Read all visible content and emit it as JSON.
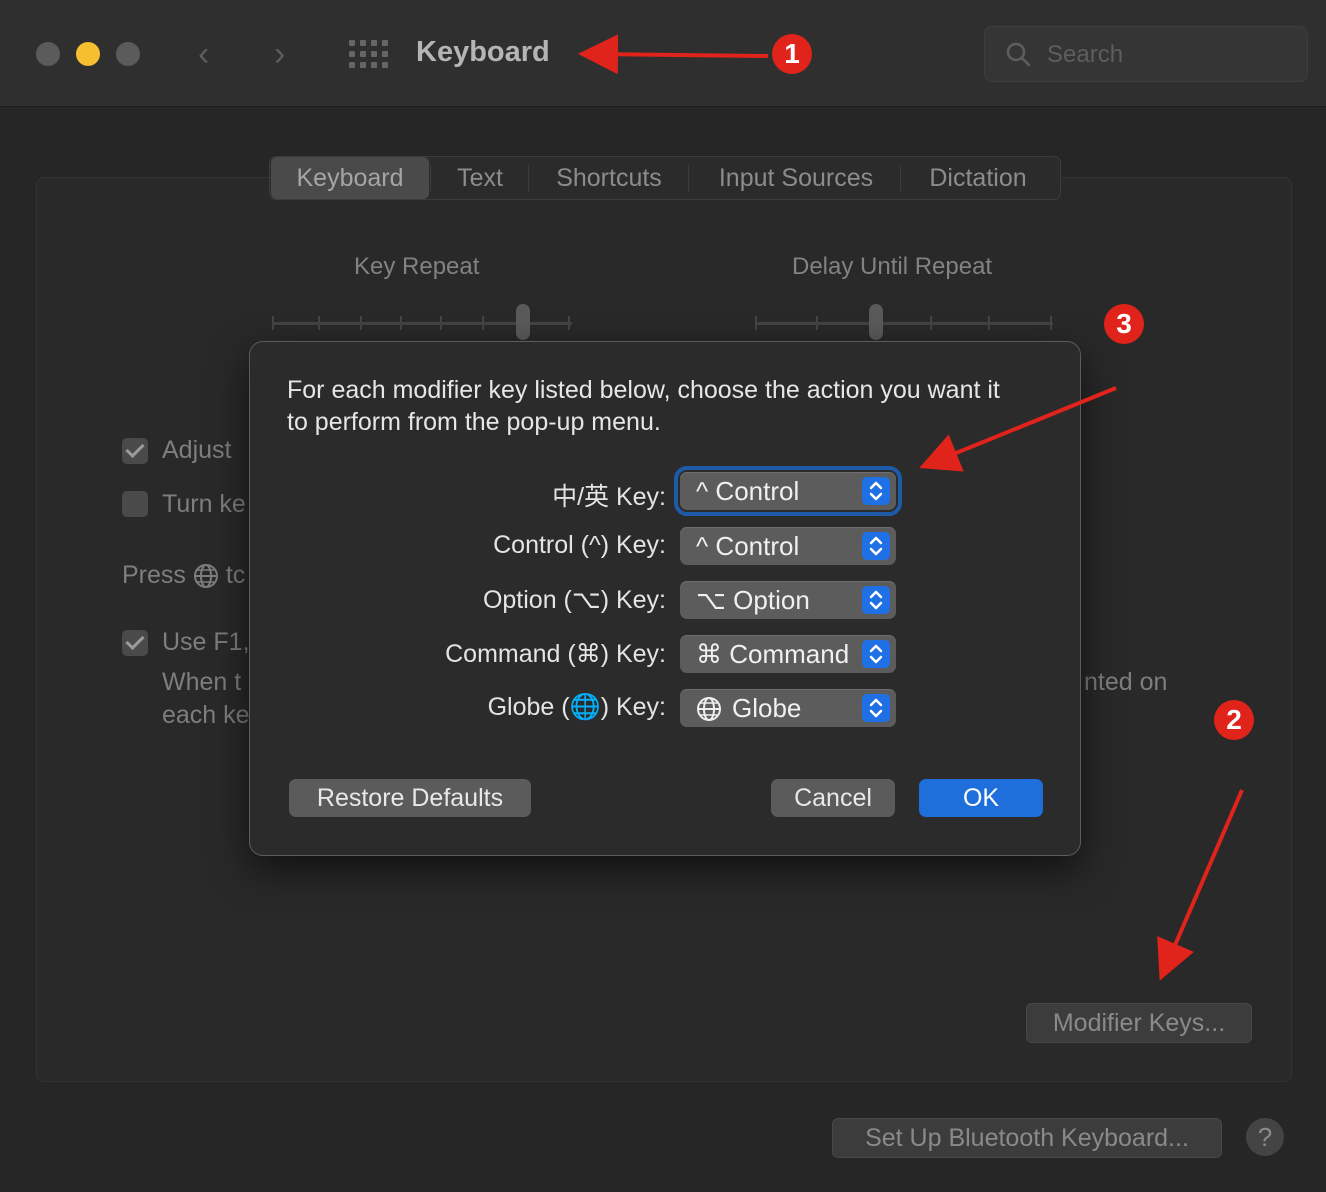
{
  "window": {
    "title": "Keyboard",
    "search_placeholder": "Search"
  },
  "tabs": [
    {
      "label": "Keyboard",
      "selected": true
    },
    {
      "label": "Text",
      "selected": false
    },
    {
      "label": "Shortcuts",
      "selected": false
    },
    {
      "label": "Input Sources",
      "selected": false
    },
    {
      "label": "Dictation",
      "selected": false
    }
  ],
  "sliders": {
    "key_repeat_label": "Key Repeat",
    "delay_label": "Delay Until Repeat"
  },
  "background": {
    "adjust_label": "Adjust",
    "turn_label": "Turn ke",
    "press_label": "Press",
    "press_suffix": "tc",
    "use_f1_label": "Use F1,",
    "when_text": "When t",
    "each_text": "each ke",
    "printed_on_text": "nted on",
    "modifier_keys_button": "Modifier Keys...",
    "bluetooth_button": "Set Up Bluetooth Keyboard...",
    "help_button": "?"
  },
  "dialog": {
    "message": "For each modifier key listed below, choose the action you want it to perform from the pop-up menu.",
    "rows": [
      {
        "label": "中/英 Key:",
        "value": "^ Control",
        "focused": true
      },
      {
        "label": "Control (^) Key:",
        "value": "^ Control",
        "focused": false
      },
      {
        "label": "Option (⌥) Key:",
        "value": "⌥ Option",
        "focused": false
      },
      {
        "label": "Command (⌘) Key:",
        "value": "⌘ Command",
        "focused": false
      },
      {
        "label": "Globe (🌐) Key:",
        "value": "Globe",
        "focused": false
      }
    ],
    "restore_button": "Restore Defaults",
    "cancel_button": "Cancel",
    "ok_button": "OK"
  },
  "annotations": [
    "1",
    "2",
    "3"
  ],
  "colors": {
    "accent": "#1e6fdc",
    "annotation": "#e0231b",
    "minimize": "#f5bf30"
  }
}
